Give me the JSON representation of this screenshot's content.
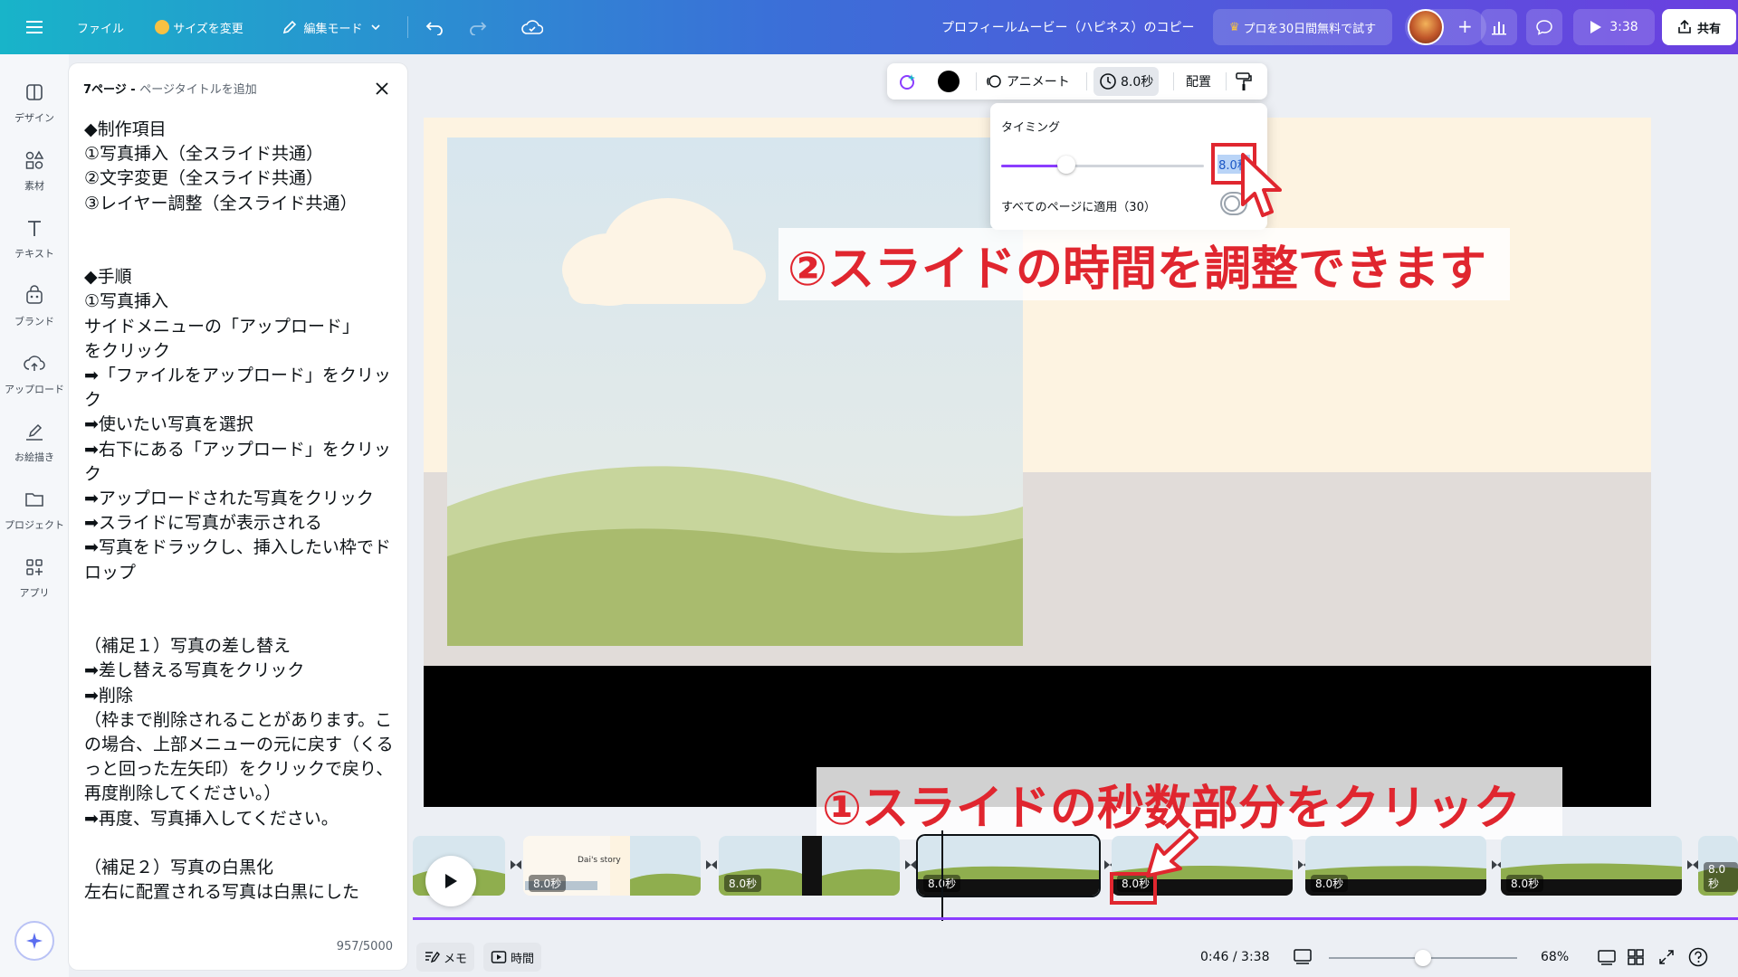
{
  "topbar": {
    "menu_icon": "hamburger-icon",
    "file_label": "ファイル",
    "resize_label": "サイズを変更",
    "edit_mode_label": "編集モード",
    "doc_title": "プロフィールムービー（ハピネス）のコピー",
    "pro_trial_label": "プロを30日間無料で試す",
    "play_duration": "3:38",
    "share_label": "共有"
  },
  "rail": {
    "items": [
      {
        "label": "デザイン",
        "icon": "design-icon"
      },
      {
        "label": "素材",
        "icon": "elements-icon"
      },
      {
        "label": "テキスト",
        "icon": "text-icon"
      },
      {
        "label": "ブランド",
        "icon": "brand-icon"
      },
      {
        "label": "アップロード",
        "icon": "upload-icon"
      },
      {
        "label": "お絵描き",
        "icon": "draw-icon"
      },
      {
        "label": "プロジェクト",
        "icon": "folder-icon"
      },
      {
        "label": "アプリ",
        "icon": "apps-icon"
      }
    ]
  },
  "notes": {
    "page_label": "7ページ - ",
    "title_placeholder": "ページタイトルを追加",
    "body": "◆制作項目\n①写真挿入（全スライド共通）\n②文字変更（全スライド共通）\n③レイヤー調整（全スライド共通）\n\n\n◆手順\n①写真挿入\nサイドメニューの「アップロード」\nをクリック\n➡「ファイルをアップロード」をクリック\n➡使いたい写真を選択\n➡右下にある「アップロード」をクリック\n➡アップロードされた写真をクリック\n➡スライドに写真が表示される\n➡写真をドラックし、挿入したい枠でドロップ\n\n\n（補足１）写真の差し替え\n➡差し替える写真をクリック\n➡削除\n（枠まで削除されることがあります。この場合、上部メニューの元に戻す（くるっと回った左矢印）をクリックで戻り、再度削除してください。）\n➡再度、写真挿入してください。\n\n（補足２）写真の白黒化\n左右に配置される写真は白黒にした",
    "char_count": "957/5000"
  },
  "context_toolbar": {
    "animate_label": "アニメート",
    "duration_label": "8.0秒",
    "position_label": "配置"
  },
  "timing_popover": {
    "title": "タイミング",
    "value": "8.0秒",
    "slider_fraction": 0.32,
    "apply_all_label": "すべてのページに適用（30）"
  },
  "annotations": {
    "callout_top": "②スライドの時間を調整できます",
    "callout_bottom": "①スライドの秒数部分をクリック"
  },
  "timeline": {
    "clip_durations": [
      "8.0秒",
      "8.0秒",
      "8.0秒",
      "8.0秒",
      "8.0秒",
      "8.0秒",
      "8.0秒"
    ],
    "clip_text": "Dai's story"
  },
  "footer": {
    "notes_label": "メモ",
    "timer_label": "時間",
    "time_position": "0:46 / 3:38",
    "zoom": "68%",
    "zoom_fraction": 0.5
  },
  "colors": {
    "accent": "#8b3dff",
    "callout_red": "#e0262f",
    "topbar_start": "#18b4c9",
    "topbar_end": "#6b3fe0"
  }
}
